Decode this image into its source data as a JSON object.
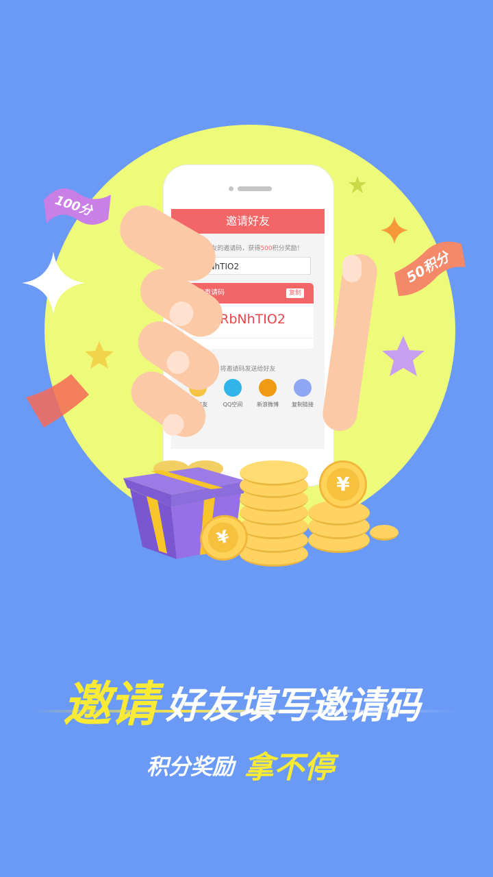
{
  "phone": {
    "header_title": "邀请好友",
    "fill_hint_prefix": "填写好友的邀请码，获得",
    "fill_hint_points": "500",
    "fill_hint_suffix": "积分奖励！",
    "input_value": "qRbNhTIO2",
    "code_card_title": "您的邀请码",
    "copy_label": "复制",
    "code_value": "qRbNhTIO2",
    "send_hint": "将邀请码发送给好友",
    "share": [
      {
        "label": "QQ好友",
        "icon": "qq-friend-icon",
        "color": "#f8c242"
      },
      {
        "label": "QQ空间",
        "icon": "qzone-icon",
        "color": "#31b5e8"
      },
      {
        "label": "新浪微博",
        "icon": "weibo-icon",
        "color": "#f09a13"
      },
      {
        "label": "复制链接",
        "icon": "copy-link-icon",
        "color": "#8ea6f4"
      }
    ]
  },
  "decor": {
    "ribbon_left": "100分",
    "ribbon_right": "50积分",
    "coin_symbol": "¥"
  },
  "banner": {
    "headline_accent": "邀请",
    "headline_rest": "好友填写邀请码",
    "sub_main": "积分奖励",
    "sub_accent": "拿不停"
  },
  "colors": {
    "background": "#6a9af5",
    "circle": "#eefa7a",
    "header_red": "#f36668",
    "accent_yellow": "#f8ea35"
  }
}
